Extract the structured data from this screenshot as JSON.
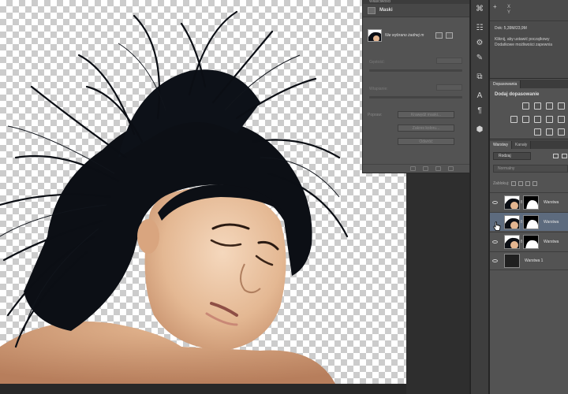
{
  "properties_panel": {
    "title": "Właściwości",
    "section_title": "Maski",
    "mask_selection_label": "Nie wybrano żadnej m",
    "density_label": "Gęstość:",
    "feather_label": "Wtapianie:",
    "refine_label": "Popraw:",
    "mask_edge_button": "Krawędź maski...",
    "color_range_button": "Zakres koloru...",
    "invert_button": "Odwróć"
  },
  "info_panel": {
    "coord_x_label": "X",
    "coord_y_label": "Y",
    "doc_size": "Dok: 5,39M/23,9M",
    "hint_line1": "Kliknij, aby ustawić początkowy",
    "hint_line2": "Dodatkowe możliwości zapewnia"
  },
  "adjustments_panel": {
    "tab_label": "Dopasowania",
    "title": "Dodaj dopasowanie"
  },
  "layers_panel": {
    "tabs": [
      "Warstwy",
      "Kanały"
    ],
    "kind_filter": "Rodzaj",
    "blend_mode": "Normalny",
    "lock_label": "Zablokuj:",
    "layers": [
      {
        "name": "Warstwa",
        "has_mask": true,
        "selected": false,
        "visible": true
      },
      {
        "name": "Warstwa",
        "has_mask": true,
        "selected": true,
        "visible": false
      },
      {
        "name": "Warstwa",
        "has_mask": true,
        "selected": false,
        "visible": true
      },
      {
        "name": "Warstwa 1",
        "has_mask": false,
        "selected": false,
        "visible": true
      }
    ]
  },
  "colors": {
    "panel_bg": "#535353",
    "dark_bg": "#262626",
    "selected_layer": "#5d6b7e"
  }
}
